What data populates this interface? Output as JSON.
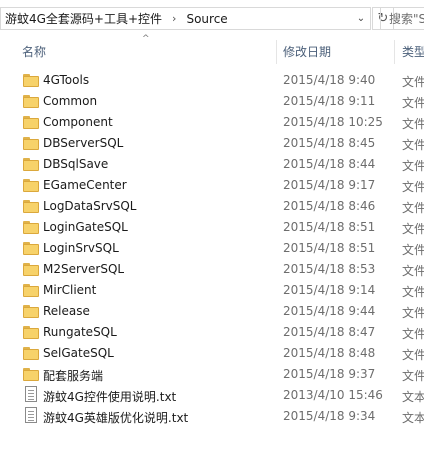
{
  "address": {
    "crumbs": [
      "游蚊4G全套源码+工具+控件",
      "Source"
    ],
    "separator": "›",
    "dropdown": "⌄",
    "refresh": "↻"
  },
  "search": {
    "placeholder": "搜索\"S"
  },
  "columns": {
    "name": "名称",
    "date": "修改日期",
    "type": "类型"
  },
  "sort_arrow": "^",
  "rows": [
    {
      "name": "4GTools",
      "date": "2015/4/18 9:40",
      "type": "文件",
      "kind": "folder"
    },
    {
      "name": "Common",
      "date": "2015/4/18 9:11",
      "type": "文件",
      "kind": "folder"
    },
    {
      "name": "Component",
      "date": "2015/4/18 10:25",
      "type": "文件",
      "kind": "folder"
    },
    {
      "name": "DBServerSQL",
      "date": "2015/4/18 8:45",
      "type": "文件",
      "kind": "folder"
    },
    {
      "name": "DBSqlSave",
      "date": "2015/4/18 8:44",
      "type": "文件",
      "kind": "folder"
    },
    {
      "name": "EGameCenter",
      "date": "2015/4/18 9:17",
      "type": "文件",
      "kind": "folder"
    },
    {
      "name": "LogDataSrvSQL",
      "date": "2015/4/18 8:46",
      "type": "文件",
      "kind": "folder"
    },
    {
      "name": "LoginGateSQL",
      "date": "2015/4/18 8:51",
      "type": "文件",
      "kind": "folder"
    },
    {
      "name": "LoginSrvSQL",
      "date": "2015/4/18 8:51",
      "type": "文件",
      "kind": "folder"
    },
    {
      "name": "M2ServerSQL",
      "date": "2015/4/18 8:53",
      "type": "文件",
      "kind": "folder"
    },
    {
      "name": "MirClient",
      "date": "2015/4/18 9:14",
      "type": "文件",
      "kind": "folder"
    },
    {
      "name": "Release",
      "date": "2015/4/18 9:44",
      "type": "文件",
      "kind": "folder"
    },
    {
      "name": "RungateSQL",
      "date": "2015/4/18 8:47",
      "type": "文件",
      "kind": "folder"
    },
    {
      "name": "SelGateSQL",
      "date": "2015/4/18 8:48",
      "type": "文件",
      "kind": "folder"
    },
    {
      "name": "配套服务端",
      "date": "2015/4/18 9:37",
      "type": "文件",
      "kind": "folder"
    },
    {
      "name": "游蚊4G控件使用说明.txt",
      "date": "2013/4/10 15:46",
      "type": "文本",
      "kind": "text"
    },
    {
      "name": "游蚊4G英雄版优化说明.txt",
      "date": "2015/4/18 9:34",
      "type": "文本",
      "kind": "text"
    }
  ]
}
